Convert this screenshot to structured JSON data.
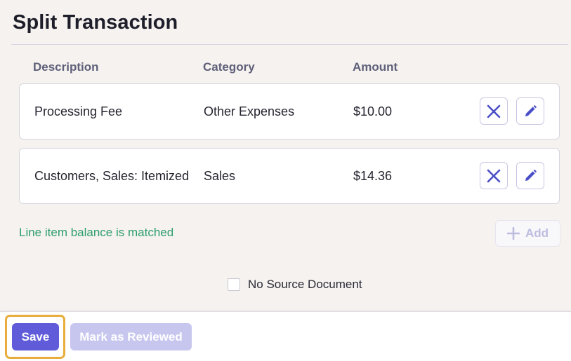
{
  "page": {
    "title": "Split Transaction"
  },
  "table": {
    "headers": {
      "description": "Description",
      "category": "Category",
      "amount": "Amount"
    },
    "rows": [
      {
        "description": "Processing Fee",
        "category": "Other Expenses",
        "amount": "$10.00",
        "delete_icon": "close-icon",
        "edit_icon": "pencil-icon"
      },
      {
        "description": "Customers, Sales: Itemized",
        "category": "Sales",
        "amount": "$14.36",
        "delete_icon": "close-icon",
        "edit_icon": "pencil-icon"
      }
    ]
  },
  "balance_status": {
    "text": "Line item balance is matched",
    "color": "#2f9e6c"
  },
  "add_button": {
    "label": "Add",
    "icon": "plus-icon",
    "disabled": true
  },
  "no_source_document": {
    "label": "No Source Document",
    "checked": false
  },
  "footer": {
    "save_label": "Save",
    "mark_reviewed_label": "Mark as Reviewed",
    "mark_reviewed_disabled": true,
    "focus_color": "#e8ad3c"
  },
  "colors": {
    "accent": "#5f5bd9",
    "accent_disabled": "#c7c6ef",
    "icon_blue": "#4a4fc7"
  }
}
